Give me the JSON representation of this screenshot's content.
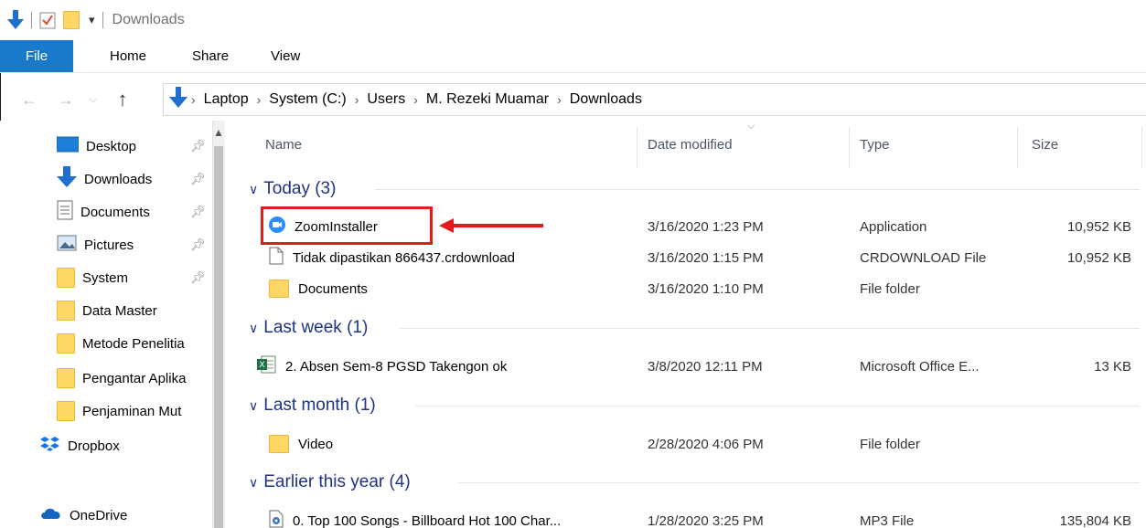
{
  "titlebar": {
    "title": "Downloads",
    "dropdown": "▾"
  },
  "ribbon": {
    "file": "File",
    "tabs": [
      "Home",
      "Share",
      "View"
    ]
  },
  "address": {
    "crumbs": [
      "Laptop",
      "System (C:)",
      "Users",
      "M. Rezeki Muamar",
      "Downloads"
    ]
  },
  "nav": {
    "items": [
      {
        "label": "Desktop",
        "icon": "desktop-icon",
        "pinned": true
      },
      {
        "label": "Downloads",
        "icon": "downloads-icon",
        "pinned": true
      },
      {
        "label": "Documents",
        "icon": "documents-icon",
        "pinned": true
      },
      {
        "label": "Pictures",
        "icon": "pictures-icon",
        "pinned": true
      },
      {
        "label": "System",
        "icon": "folder-icon",
        "pinned": true
      },
      {
        "label": "Data Master",
        "icon": "folder-icon",
        "pinned": false
      },
      {
        "label": "Metode Penelitia",
        "icon": "folder-icon",
        "pinned": false
      },
      {
        "label": "Pengantar Aplika",
        "icon": "folder-icon",
        "pinned": false
      },
      {
        "label": "Penjaminan Mut",
        "icon": "folder-icon",
        "pinned": false
      },
      {
        "label": "Dropbox",
        "icon": "dropbox-icon",
        "pinned": false
      },
      {
        "label": "OneDrive",
        "icon": "onedrive-icon",
        "pinned": false
      }
    ]
  },
  "columns": {
    "name": "Name",
    "date": "Date modified",
    "type": "Type",
    "size": "Size"
  },
  "groups": [
    {
      "label": "Today (3)",
      "files": [
        {
          "name": "ZoomInstaller",
          "date": "3/16/2020 1:23 PM",
          "type": "Application",
          "size": "10,952 KB",
          "icon": "zoom-icon"
        },
        {
          "name": "Tidak dipastikan 866437.crdownload",
          "date": "3/16/2020 1:15 PM",
          "type": "CRDOWNLOAD File",
          "size": "10,952 KB",
          "icon": "blank-file-icon"
        },
        {
          "name": "Documents",
          "date": "3/16/2020 1:10 PM",
          "type": "File folder",
          "size": "",
          "icon": "folder-icon"
        }
      ]
    },
    {
      "label": "Last week (1)",
      "files": [
        {
          "name": "2. Absen Sem-8 PGSD Takengon ok",
          "date": "3/8/2020 12:11 PM",
          "type": "Microsoft Office E...",
          "size": "13 KB",
          "icon": "excel-icon"
        }
      ]
    },
    {
      "label": "Last month (1)",
      "files": [
        {
          "name": "Video",
          "date": "2/28/2020 4:06 PM",
          "type": "File folder",
          "size": "",
          "icon": "folder-icon"
        }
      ]
    },
    {
      "label": "Earlier this year (4)",
      "files": [
        {
          "name": "0. Top 100 Songs - Billboard Hot 100 Char...",
          "date": "1/28/2020 3:25 PM",
          "type": "MP3 File",
          "size": "135,804 KB",
          "icon": "mp3-icon"
        }
      ]
    }
  ],
  "colors": {
    "file_tab": "#1979ca",
    "group_text": "#1e3287",
    "annotation": "#e21a1a"
  }
}
